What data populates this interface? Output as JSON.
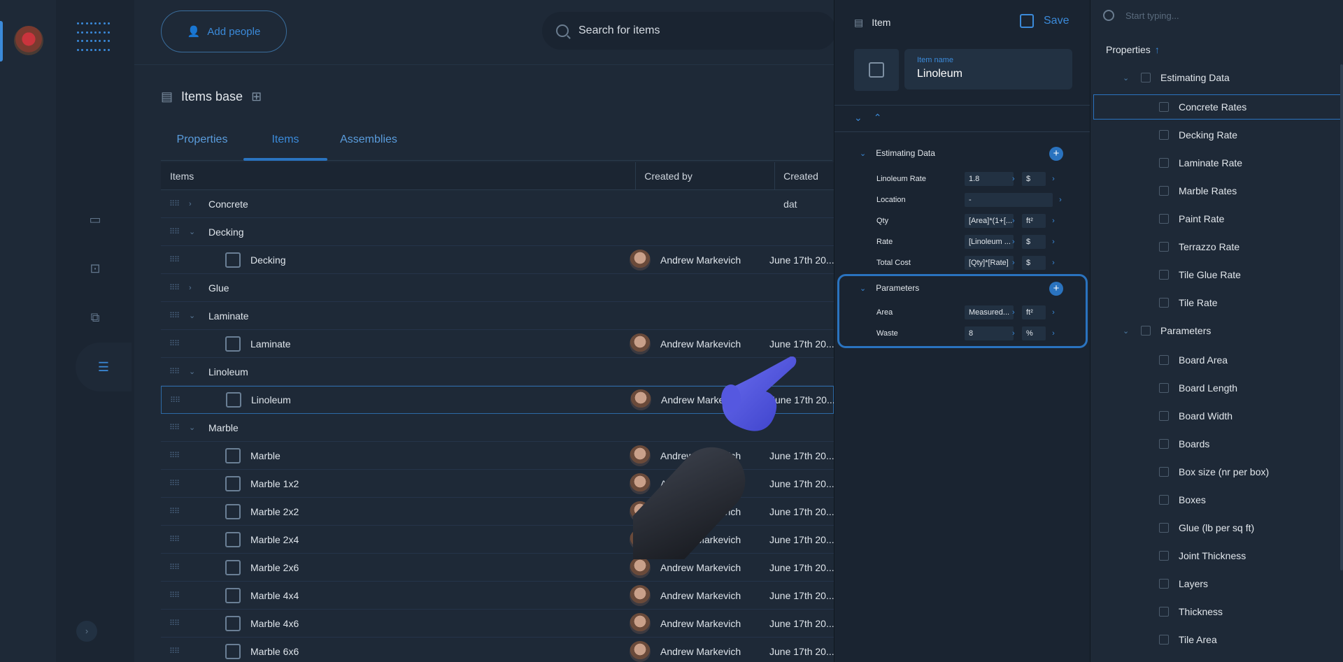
{
  "header": {
    "add_people": "Add people",
    "search_placeholder": "Search for items",
    "section_title": "Items base"
  },
  "tabs": [
    "Properties",
    "Items",
    "Assemblies"
  ],
  "table": {
    "columns": [
      "Items",
      "Created by",
      "Created dat"
    ],
    "rows": [
      {
        "name": "Concrete",
        "type": "group",
        "open": false
      },
      {
        "name": "Decking",
        "type": "group",
        "open": true
      },
      {
        "name": "Decking",
        "type": "item",
        "creator": "Andrew Markevich",
        "date": "June 17th 20..."
      },
      {
        "name": "Glue",
        "type": "group",
        "open": false
      },
      {
        "name": "Laminate",
        "type": "group",
        "open": true
      },
      {
        "name": "Laminate",
        "type": "item",
        "creator": "Andrew Markevich",
        "date": "June 17th 20..."
      },
      {
        "name": "Linoleum",
        "type": "group",
        "open": true
      },
      {
        "name": "Linoleum",
        "type": "item",
        "creator": "Andrew Markevich",
        "date": "June 17th 20...",
        "selected": true
      },
      {
        "name": "Marble",
        "type": "group",
        "open": true
      },
      {
        "name": "Marble",
        "type": "item",
        "creator": "Andrew Markevich",
        "date": "June 17th 20..."
      },
      {
        "name": "Marble 1x2",
        "type": "item",
        "creator": "Andrew Markevich",
        "date": "June 17th 20..."
      },
      {
        "name": "Marble 2x2",
        "type": "item",
        "creator": "Andrew Markevich",
        "date": "June 17th 20..."
      },
      {
        "name": "Marble 2x4",
        "type": "item",
        "creator": "Andrew Markevich",
        "date": "June 17th 20..."
      },
      {
        "name": "Marble 2x6",
        "type": "item",
        "creator": "Andrew Markevich",
        "date": "June 17th 20..."
      },
      {
        "name": "Marble 4x4",
        "type": "item",
        "creator": "Andrew Markevich",
        "date": "June 17th 20..."
      },
      {
        "name": "Marble 4x6",
        "type": "item",
        "creator": "Andrew Markevich",
        "date": "June 17th 20..."
      },
      {
        "name": "Marble 6x6",
        "type": "item",
        "creator": "Andrew Markevich",
        "date": "June 17th 20..."
      }
    ]
  },
  "panel": {
    "title": "Item",
    "save": "Save",
    "name_label": "Item name",
    "name_value": "Linoleum",
    "estimating_title": "Estimating Data",
    "estimating": [
      {
        "name": "Linoleum Rate",
        "value": "1.8",
        "unit": "$"
      },
      {
        "name": "Location",
        "value": "-",
        "unit": ""
      },
      {
        "name": "Qty",
        "value": "[Area]*(1+[...",
        "unit": "ft²"
      },
      {
        "name": "Rate",
        "value": "[Linoleum ...",
        "unit": "$"
      },
      {
        "name": "Total Cost",
        "value": "[Qty]*[Rate]",
        "unit": "$"
      }
    ],
    "parameters_title": "Parameters",
    "parameters": [
      {
        "name": "Area",
        "value": "Measured...",
        "unit": "ft²"
      },
      {
        "name": "Waste",
        "value": "8",
        "unit": "%"
      }
    ]
  },
  "picker": {
    "search_placeholder": "Start typing...",
    "title": "Properties",
    "sort_icon": "↑",
    "group1": "Estimating Data",
    "group1_items": [
      "Concrete Rates",
      "Decking Rate",
      "Laminate Rate",
      "Marble Rates",
      "Paint Rate",
      "Terrazzo Rate",
      "Tile Glue Rate",
      "Tile Rate"
    ],
    "group2": "Parameters",
    "group2_items": [
      "Board Area",
      "Board Length",
      "Board Width",
      "Boards",
      "Box size (nr per box)",
      "Boxes",
      "Glue (lb per sq ft)",
      "Joint Thickness",
      "Layers",
      "Thickness",
      "Tile Area"
    ]
  },
  "colors": {
    "accent": "#3b8ad9",
    "bg": "#1e2937",
    "panel": "#1a2431"
  }
}
